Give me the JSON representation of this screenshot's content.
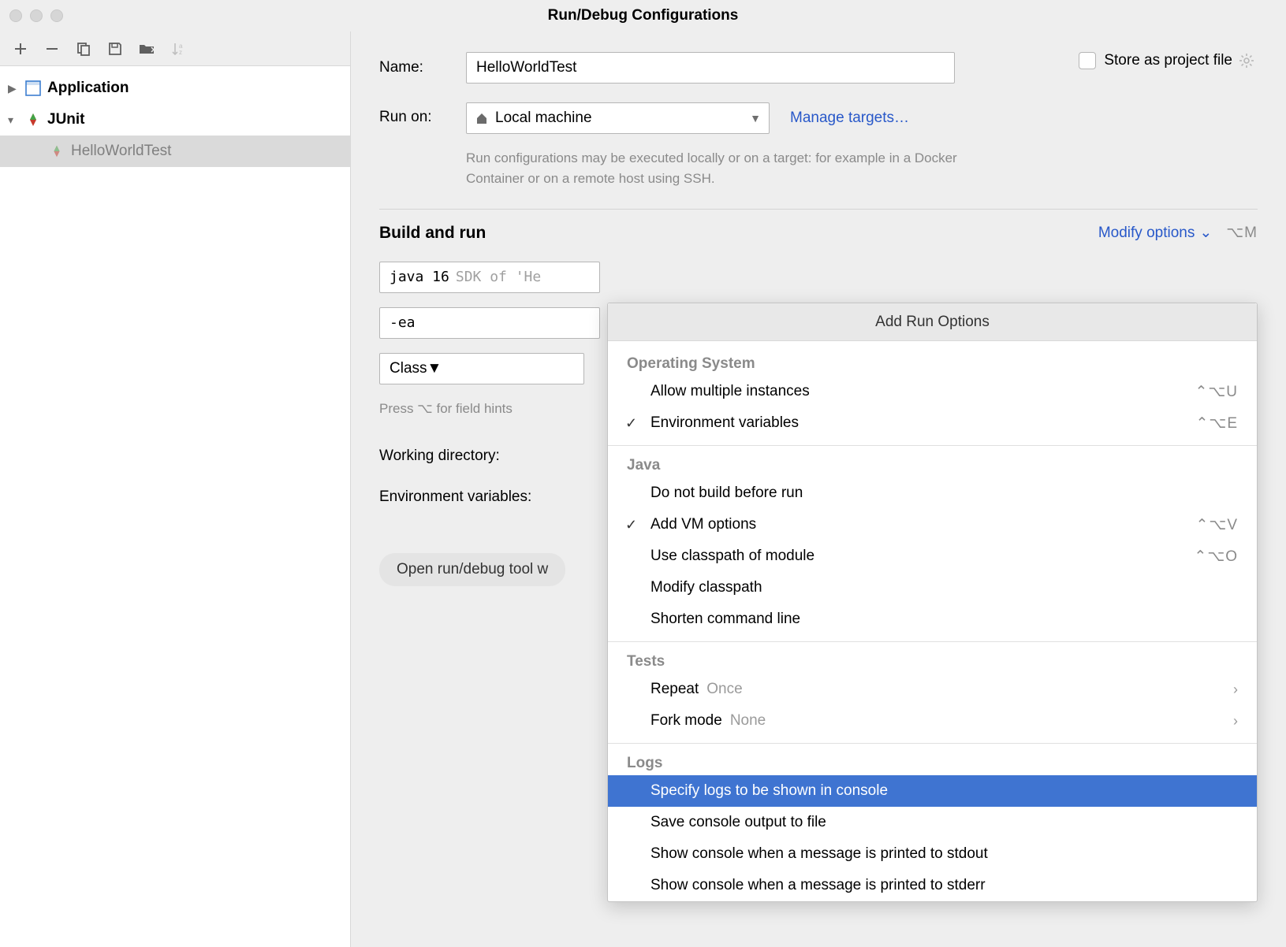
{
  "window": {
    "title": "Run/Debug Configurations"
  },
  "tree": {
    "application": "Application",
    "junit": "JUnit",
    "junit_child": "HelloWorldTest"
  },
  "form": {
    "name_label": "Name:",
    "name_value": "HelloWorldTest",
    "store_label": "Store as project file",
    "run_on_label": "Run on:",
    "run_on_value": "Local machine",
    "manage_targets": "Manage targets…",
    "run_on_hint": "Run configurations may be executed locally or on a target: for example in a Docker Container or on a remote host using SSH.",
    "build_run_title": "Build and run",
    "modify_options": "Modify options",
    "modify_shortcut": "⌥M",
    "sdk_main": "java 16",
    "sdk_grey": "SDK of 'He",
    "vm_options": "-ea",
    "class_label": "Class",
    "hints": "Press ⌥ for field hints",
    "working_dir_label": "Working directory:",
    "env_label": "Environment variables:",
    "open_tool": "Open run/debug tool w"
  },
  "popup": {
    "title": "Add Run Options",
    "groups": [
      {
        "label": "Operating System",
        "items": [
          {
            "text": "Allow multiple instances",
            "kb": "⌃⌥U"
          },
          {
            "text": "Environment variables",
            "kb": "⌃⌥E",
            "checked": true
          }
        ]
      },
      {
        "label": "Java",
        "items": [
          {
            "text": "Do not build before run"
          },
          {
            "text": "Add VM options",
            "kb": "⌃⌥V",
            "checked": true
          },
          {
            "text": "Use classpath of module",
            "kb": "⌃⌥O"
          },
          {
            "text": "Modify classpath"
          },
          {
            "text": "Shorten command line"
          }
        ]
      },
      {
        "label": "Tests",
        "items": [
          {
            "text": "Repeat",
            "value": "Once",
            "chev": true
          },
          {
            "text": "Fork mode",
            "value": "None",
            "chev": true
          }
        ]
      },
      {
        "label": "Logs",
        "items": [
          {
            "text": "Specify logs to be shown in console",
            "selected": true
          },
          {
            "text": "Save console output to file"
          },
          {
            "text": "Show console when a message is printed to stdout"
          },
          {
            "text": "Show console when a message is printed to stderr"
          }
        ]
      }
    ]
  }
}
